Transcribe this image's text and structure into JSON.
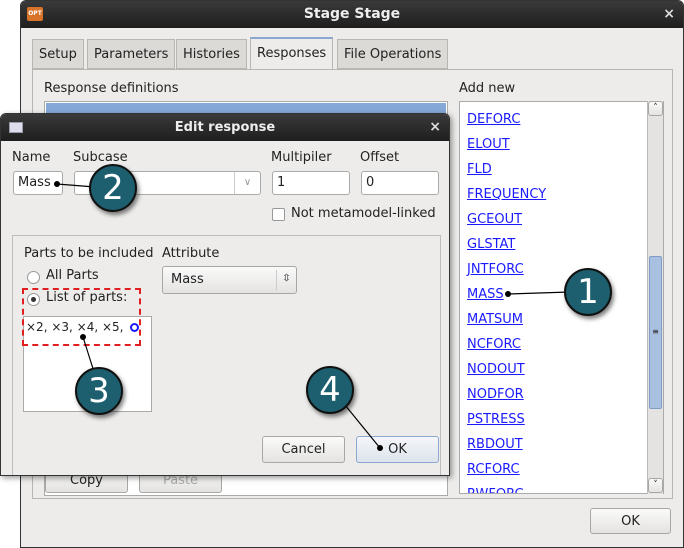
{
  "main_window": {
    "title": "Stage Stage",
    "app_icon": "OPT",
    "close": "×",
    "tabs": [
      "Setup",
      "Parameters",
      "Histories",
      "Responses",
      "File Operations"
    ],
    "active_tab": "Responses",
    "response_definitions_label": "Response definitions",
    "add_new_label": "Add new",
    "add_new_items": [
      "DEFORC",
      "ELOUT",
      "FLD",
      "FREQUENCY",
      "GCEOUT",
      "GLSTAT",
      "JNTFORC",
      "MASS",
      "MATSUM",
      "NCFORC",
      "NODOUT",
      "NODFOR",
      "PSTRESS",
      "RBDOUT",
      "RCFORC",
      "RWFORC"
    ],
    "copy_label": "Copy",
    "paste_label": "Paste",
    "ok_label": "OK"
  },
  "dialog": {
    "title": "Edit response",
    "close": "×",
    "name_label": "Name",
    "name_value": "Mass",
    "subcase_label": "Subcase",
    "subcase_value": "",
    "multiplier_label": "Multipiler",
    "multiplier_value": "1",
    "offset_label": "Offset",
    "offset_value": "0",
    "not_metamodel_label": "Not metamodel-linked",
    "not_metamodel_checked": false,
    "parts_label": "Parts to be included",
    "all_parts_label": "All Parts",
    "list_of_parts_label": "List of parts:",
    "selected_parts_option": "List of parts:",
    "parts_value": "×2, ×3, ×4, ×5,",
    "attribute_label": "Attribute",
    "attribute_value": "Mass",
    "cancel_label": "Cancel",
    "ok_label": "OK"
  },
  "callouts": [
    "1",
    "2",
    "3",
    "4"
  ],
  "colors": {
    "callout": "#1d5f6e",
    "link": "#1a1aff",
    "selection": "#86a8d8",
    "highlight_box": "#e02020"
  }
}
